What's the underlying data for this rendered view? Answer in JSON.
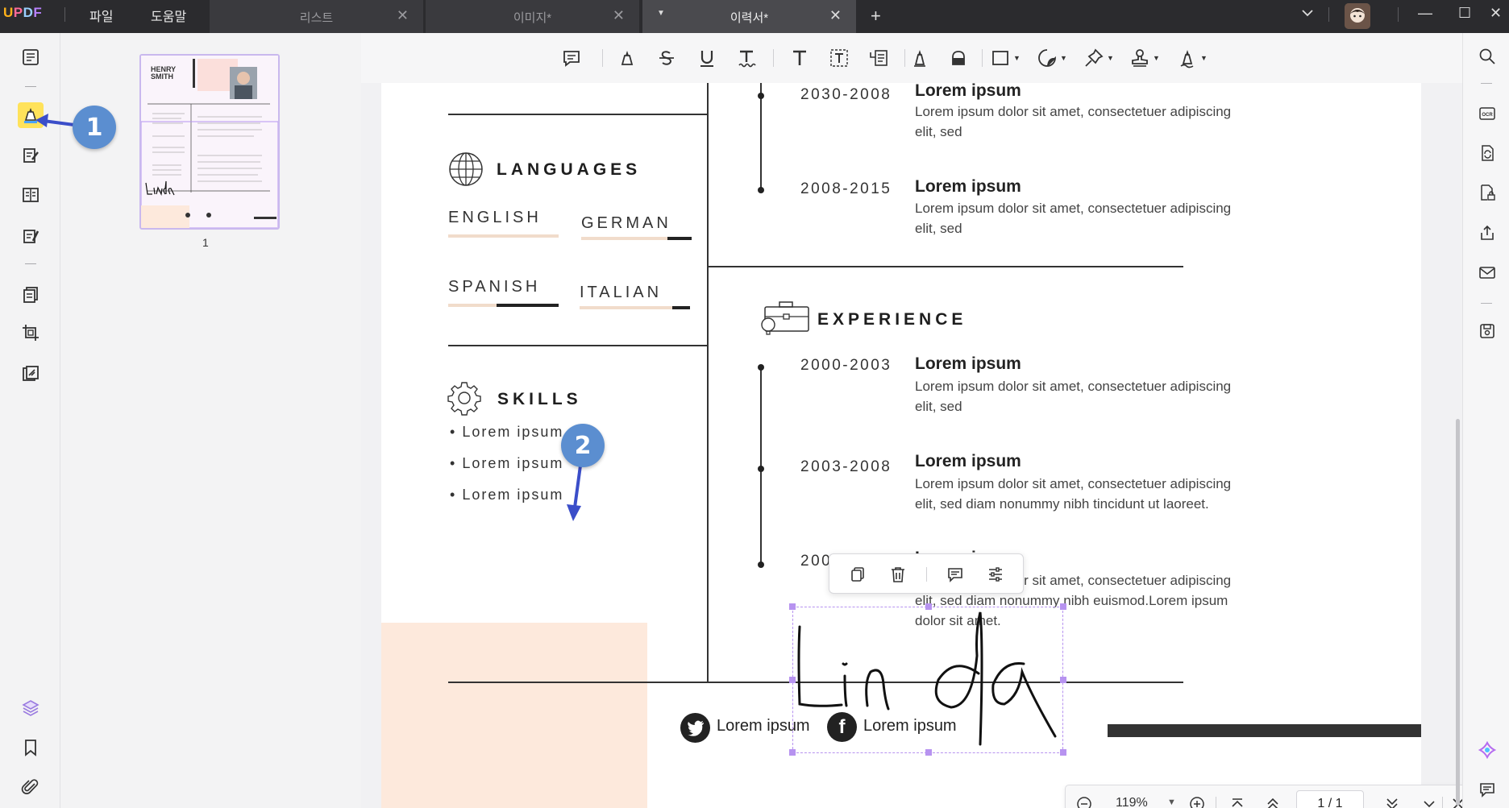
{
  "app": {
    "logo": [
      "U",
      "P",
      "D",
      "F"
    ],
    "menus": [
      "파일",
      "도움말"
    ],
    "tabs": [
      {
        "label": "리스트",
        "active": false
      },
      {
        "label": "이미지*",
        "active": false
      },
      {
        "label": "이력서*",
        "active": true
      }
    ],
    "add_tab": "+",
    "window_buttons": {
      "minimize": "—",
      "maximize": "☐",
      "close": "✕"
    }
  },
  "left_rail": {
    "items": [
      "reader-icon",
      "comment-icon",
      "edit-icon",
      "organize-icon",
      "form-icon",
      "pages-icon",
      "crop-icon",
      "protect-icon",
      "layers-icon",
      "bookmark-icon",
      "attachment-icon"
    ]
  },
  "thumbnails": {
    "page_number": "1",
    "thumb_name_line1": "HENRY",
    "thumb_name_line2": "SMITH",
    "thumb_signature": "Linda"
  },
  "toolbar": {
    "tools": [
      "sticky-note-icon",
      "highlight-icon",
      "strikethrough-icon",
      "underline-icon",
      "squiggly-icon",
      "text-icon",
      "textbox-icon",
      "text-callout-icon",
      "pencil-icon",
      "eraser-icon",
      "shape-icon",
      "sticker-icon",
      "pin-icon",
      "stamp-icon",
      "signature-icon"
    ]
  },
  "resume": {
    "languages": {
      "heading": "LANGUAGES",
      "items": [
        {
          "name": "ENGLISH",
          "level": 0.0
        },
        {
          "name": "GERMAN",
          "level": 0.25
        },
        {
          "name": "SPANISH",
          "level": 0.55
        },
        {
          "name": "ITALIAN",
          "level": 0.15
        }
      ]
    },
    "skills": {
      "heading": "SKILLS",
      "items": [
        "Lorem ipsum",
        "Lorem ipsum",
        "Lorem ipsum"
      ],
      "bullet": "•"
    },
    "education_entries": [
      {
        "years": "2030-2008",
        "title": "Lorem ipsum",
        "text": "Lorem ipsum dolor sit amet, consectetuer adipiscing elit, sed"
      },
      {
        "years": "2008-2015",
        "title": "Lorem ipsum",
        "text": "Lorem ipsum dolor sit amet, consectetuer adipiscing elit, sed"
      }
    ],
    "experience": {
      "heading": "EXPERIENCE",
      "entries": [
        {
          "years": "2000-2003",
          "title": "Lorem ipsum",
          "text": "Lorem ipsum dolor sit amet, consectetuer adipiscing elit, sed"
        },
        {
          "years": "2003-2008",
          "title": "Lorem ipsum",
          "text": "Lorem ipsum dolor sit amet, consectetuer adipiscing elit, sed diam nonummy nibh tincidunt ut laoreet."
        },
        {
          "years": "2008-2015",
          "title": "Lorem ipsum",
          "text": "Lorem ipsum dolor sit amet, consectetuer adipiscing elit, sed diam nonummy nibh euismod.Lorem ipsum dolor sit amet."
        }
      ]
    },
    "social": [
      {
        "icon": "twitter-icon",
        "text": "Lorem ipsum"
      },
      {
        "icon": "facebook-icon",
        "text": "Lorem ipsum"
      }
    ],
    "signature": "Linda"
  },
  "page_nav": {
    "zoom": "119%",
    "page_display": "1 / 1"
  },
  "callouts": [
    "1",
    "2"
  ],
  "colors": {
    "accent_purple": "#b793f0",
    "callout_blue": "#5b8ed0",
    "highlight_yellow": "#ffe25a",
    "resume_peach": "#fde9dc"
  }
}
